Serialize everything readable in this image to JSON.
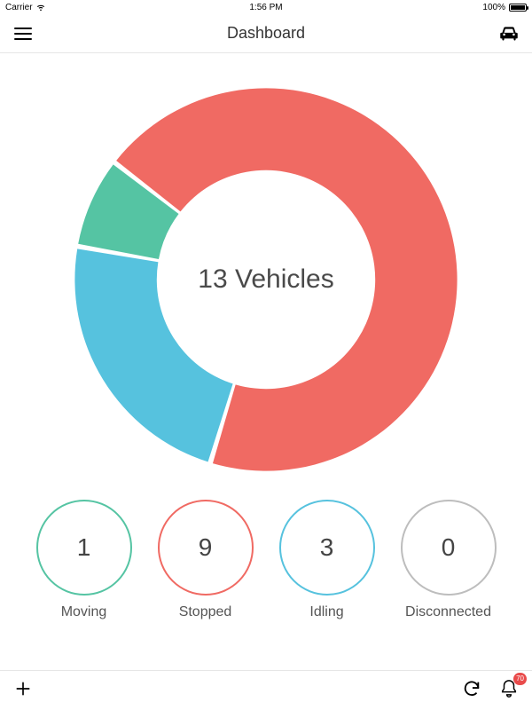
{
  "statusbar": {
    "carrier": "Carrier",
    "time": "1:56 PM",
    "battery": "100%"
  },
  "header": {
    "title": "Dashboard"
  },
  "donut": {
    "center_text": "13 Vehicles"
  },
  "stats": [
    {
      "label": "Moving",
      "value": "1",
      "color": "#55c4a3"
    },
    {
      "label": "Stopped",
      "value": "9",
      "color": "#f06a63"
    },
    {
      "label": "Idling",
      "value": "3",
      "color": "#56c2de"
    },
    {
      "label": "Disconnected",
      "value": "0",
      "color": "#bdbdbd"
    }
  ],
  "bottom": {
    "notif_badge": "70"
  },
  "chart_data": {
    "type": "pie",
    "title": "13 Vehicles",
    "series": [
      {
        "name": "Moving",
        "value": 1,
        "color": "#55c4a3"
      },
      {
        "name": "Stopped",
        "value": 9,
        "color": "#f06a63"
      },
      {
        "name": "Idling",
        "value": 3,
        "color": "#56c2de"
      },
      {
        "name": "Disconnected",
        "value": 0,
        "color": "#bdbdbd"
      }
    ],
    "donut_hole": true
  }
}
